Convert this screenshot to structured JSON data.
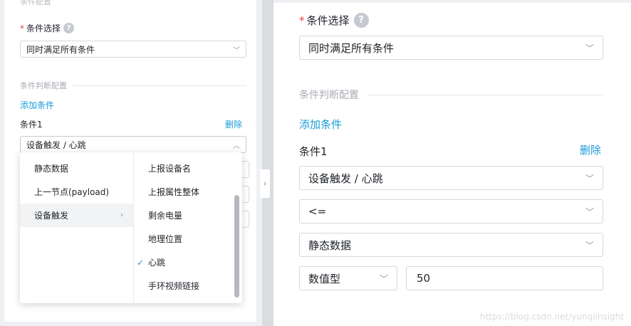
{
  "left": {
    "top_section_title": "条件配置",
    "condition_select_label": "条件选择",
    "help_glyph": "?",
    "condition_select_value": "同时满足所有条件",
    "judge_section_title": "条件判断配置",
    "add_condition": "添加条件",
    "condition_title": "条件1",
    "delete": "删除",
    "trigger_select_value": "设备触发 / 心跳",
    "cascader": {
      "level1": [
        "静态数据",
        "上一节点(payload)",
        "设备触发"
      ],
      "level1_active": "设备触发",
      "level2": [
        "上报设备名",
        "上报属性整体",
        "剩余电量",
        "地理位置",
        "心跳",
        "手环视频链接"
      ],
      "level2_checked": "心跳"
    }
  },
  "right": {
    "condition_select_label": "条件选择",
    "help_glyph": "?",
    "condition_select_value": "同时满足所有条件",
    "judge_section_title": "条件判断配置",
    "add_condition": "添加条件",
    "condition_title": "条件1",
    "delete": "删除",
    "trigger_select_value": "设备触发 / 心跳",
    "operator_value": "<=",
    "source_value": "静态数据",
    "type_value": "数值型",
    "input_value": "50"
  },
  "watermark": "https://blog.csdn.net/yunqiinsight",
  "colors": {
    "link": "#1a9bd8",
    "required": "#e6413f",
    "border": "#d5d8de"
  },
  "icons": {
    "help": "help-circle-icon",
    "chevron_down": "chevron-down-icon",
    "chevron_up": "chevron-up-icon",
    "chevron_right": "chevron-right-icon",
    "check": "check-icon"
  }
}
